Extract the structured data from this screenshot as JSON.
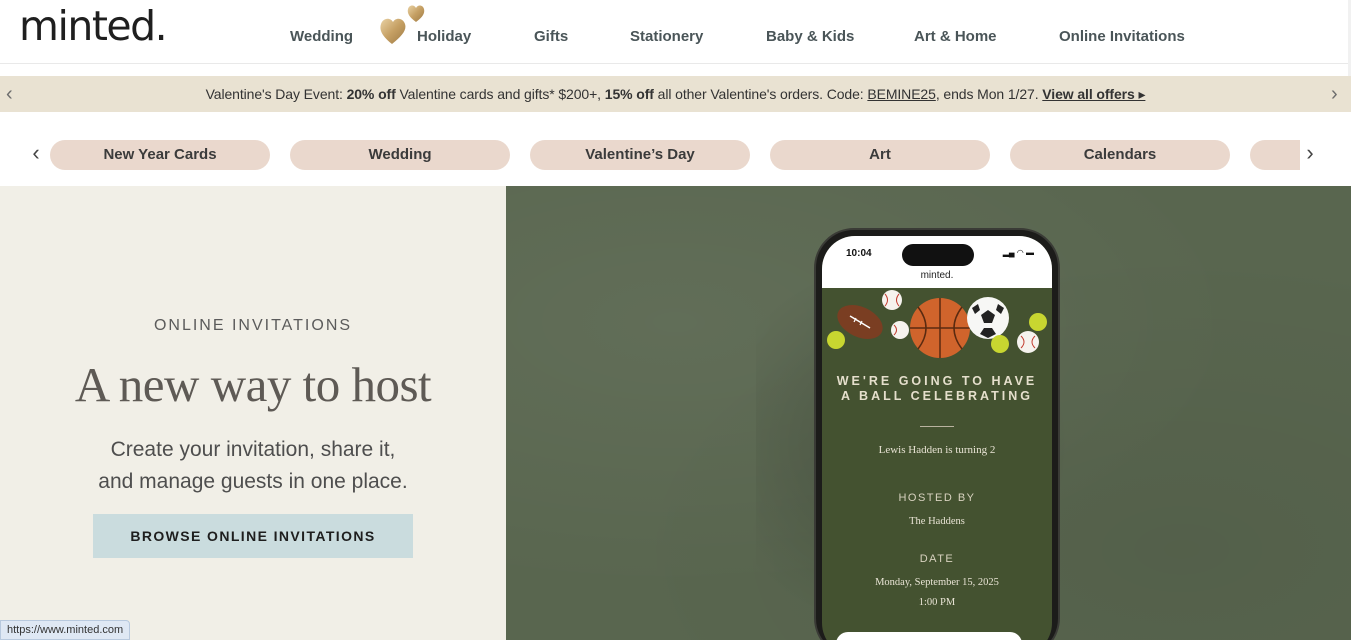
{
  "header": {
    "logo": "minted.",
    "nav": [
      {
        "id": "wedding",
        "label": "Wedding"
      },
      {
        "id": "holiday",
        "label": "Holiday"
      },
      {
        "id": "gifts",
        "label": "Gifts"
      },
      {
        "id": "stationery",
        "label": "Stationery"
      },
      {
        "id": "baby-kids",
        "label": "Baby & Kids"
      },
      {
        "id": "art-home",
        "label": "Art & Home"
      },
      {
        "id": "online-invitations",
        "label": "Online Invitations"
      }
    ],
    "hearts_icon": "gold-hearts-icon"
  },
  "promo": {
    "prefix": "Valentine's Day Event: ",
    "discount1": "20% off",
    "text1": " Valentine cards and gifts* $200+, ",
    "discount2": "15% off",
    "text2": " all other Valentine's orders. Code: ",
    "code": "BEMINE25",
    "text3": ", ends Mon 1/27. ",
    "view_all": "View all offers ▸",
    "prev_icon": "chevron-left-icon",
    "next_icon": "chevron-right-icon"
  },
  "categories": {
    "items": [
      "New Year Cards",
      "Wedding",
      "Valentine’s Day",
      "Art",
      "Calendars",
      ""
    ],
    "prev_icon": "chevron-left-icon",
    "next_icon": "chevron-right-icon"
  },
  "hero": {
    "eyebrow": "ONLINE INVITATIONS",
    "headline": "A new way to host",
    "sub_line1": "Create your invitation, share it,",
    "sub_line2": "and manage guests in one place.",
    "cta": "BROWSE ONLINE INVITATIONS"
  },
  "phone": {
    "time": "10:04",
    "app_logo": "minted.",
    "heading_line1": "WE'RE GOING TO HAVE",
    "heading_line2": "A BALL CELEBRATING",
    "name_line": "Lewis Hadden is turning 2",
    "hosted_label": "HOSTED BY",
    "hosted_value": "The Haddens",
    "date_label": "DATE",
    "date_value": "Monday, September 15, 2025",
    "time_value": "1:00 PM"
  },
  "status_bar_url": "https://www.minted.com",
  "colors": {
    "promo_bg": "#e9e2d2",
    "pill_bg": "#ead8cd",
    "hero_left_bg": "#f1efe7",
    "hero_right_bg": "#59664f",
    "cta_bg": "#cadcde",
    "nav_text": "#4a5558"
  }
}
